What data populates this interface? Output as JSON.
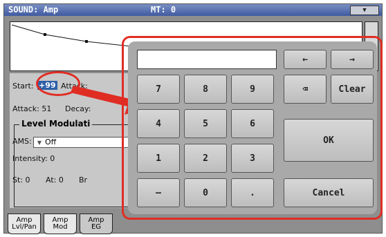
{
  "title": {
    "left": "SOUND: Amp",
    "center": "MT: 0",
    "menu_icon": "triangle-down"
  },
  "params": {
    "start_label": "Start:",
    "start_value": "+99",
    "attack_label1": "Attack:",
    "attack_row": "Attack: 51",
    "decay_label": "Decay:"
  },
  "level_mod": {
    "title": "Level Modulati",
    "ams_label": "AMS:",
    "ams_value": "Off",
    "intensity": "Intensity: 0",
    "st": "St: 0",
    "at": "At: 0",
    "br": "Br"
  },
  "tabs": [
    {
      "line1": "Amp",
      "line2": "Lvl/Pan"
    },
    {
      "line1": "Amp",
      "line2": "Mod"
    },
    {
      "line1": "Amp",
      "line2": "EG"
    }
  ],
  "keypad": {
    "display_value": "",
    "keys": {
      "left": "←",
      "right": "→",
      "k7": "7",
      "k8": "8",
      "k9": "9",
      "backspace": "⌫",
      "clear": "Clear",
      "k4": "4",
      "k5": "5",
      "k6": "6",
      "ok": "OK",
      "k1": "1",
      "k2": "2",
      "k3": "3",
      "minus": "–",
      "k0": "0",
      "dot": ".",
      "cancel": "Cancel"
    }
  },
  "colors": {
    "highlight": "#2d5fa8",
    "callout": "#e02d24",
    "title_bar": "#3f5aa0"
  }
}
